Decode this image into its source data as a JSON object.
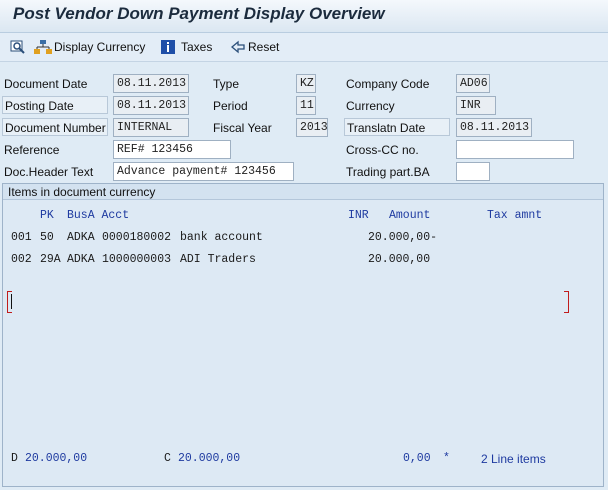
{
  "window": {
    "title": "Post Vendor Down Payment Display Overview"
  },
  "toolbar": {
    "display_currency": "Display Currency",
    "taxes": "Taxes",
    "reset": "Reset"
  },
  "header": {
    "document_date": {
      "label": "Document Date",
      "value": "08.11.2013"
    },
    "type": {
      "label": "Type",
      "value": "KZ"
    },
    "company_code": {
      "label": "Company Code",
      "value": "AD06"
    },
    "posting_date": {
      "label": "Posting Date",
      "value": "08.11.2013"
    },
    "period": {
      "label": "Period",
      "value": "11"
    },
    "currency": {
      "label": "Currency",
      "value": "INR"
    },
    "document_number": {
      "label": "Document Number",
      "value": "INTERNAL"
    },
    "fiscal_year": {
      "label": "Fiscal Year",
      "value": "2013"
    },
    "translation_date": {
      "label": "Translatn Date",
      "value": "08.11.2013"
    },
    "reference": {
      "label": "Reference",
      "value": "REF# 123456"
    },
    "cross_cc": {
      "label": "Cross-CC no.",
      "value": ""
    },
    "doc_header_text": {
      "label": "Doc.Header Text",
      "value": "Advance payment# 123456"
    },
    "trading_part": {
      "label": "Trading part.BA",
      "value": ""
    }
  },
  "items": {
    "title": "Items in document currency",
    "columns": {
      "pk": "PK",
      "busa_acct": "BusA Acct",
      "currency": "INR",
      "amount": "Amount",
      "tax_amount": "Tax amnt"
    },
    "rows": [
      {
        "line": "001",
        "pk": "50",
        "busa": "ADKA",
        "account": "0000180002",
        "name": "bank account",
        "amount": "20.000,00-"
      },
      {
        "line": "002",
        "pk": "29A",
        "busa": "ADKA",
        "account": "1000000003",
        "name": "ADI Traders",
        "amount": "20.000,00"
      }
    ]
  },
  "footer": {
    "debit_label": "D",
    "debit_value": "20.000,00",
    "credit_label": "C",
    "credit_value": "20.000,00",
    "balance": "0,00",
    "balance_flag": "*",
    "line_items": "2 Line items"
  },
  "colors": {
    "background": "#dfebf5",
    "accent_text": "#1e3aa0",
    "bracket": "#c01c1c"
  }
}
